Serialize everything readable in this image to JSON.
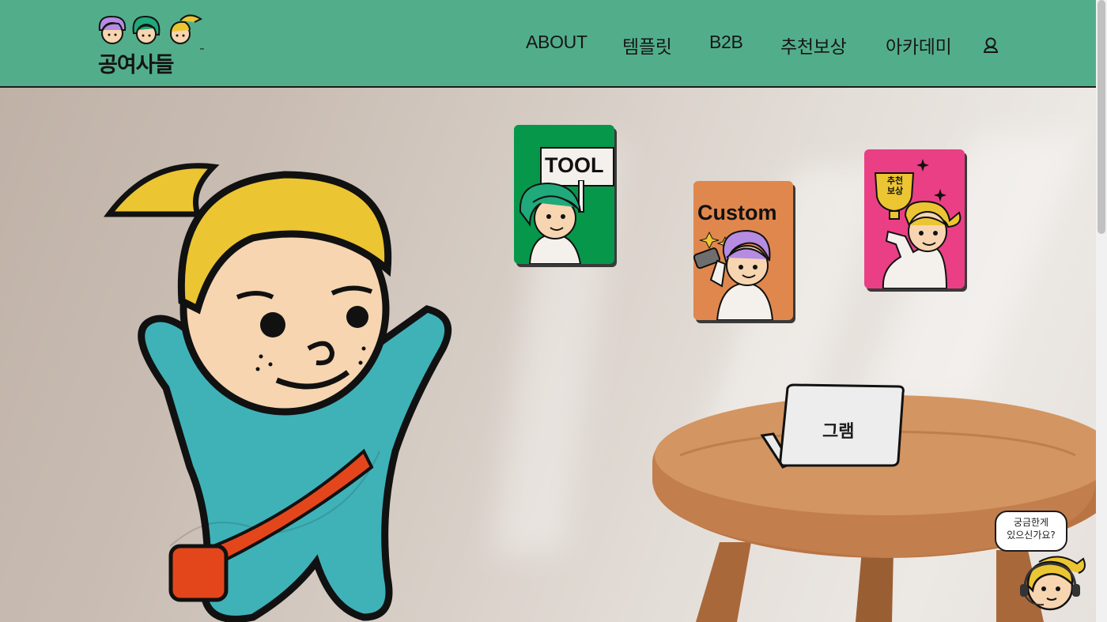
{
  "header": {
    "logo_text": "공여사들",
    "logo_tm": "™",
    "nav": [
      "ABOUT",
      "템플릿",
      "B2B",
      "추천보상",
      "아카데미"
    ],
    "user_icon": "user-icon"
  },
  "hero": {
    "cards": {
      "tool": {
        "label": "TOOL",
        "color": "#06974a"
      },
      "custom": {
        "label": "Custom",
        "color": "#e0874e"
      },
      "reward": {
        "label": "추천\n보상",
        "color": "#ea3f85"
      }
    },
    "laptop_label": "그램",
    "chat_bubble": "궁금한게\n있으신가요?"
  },
  "colors": {
    "header_bg": "#52ae8a",
    "character_hair": "#ecc532",
    "character_body": "#3fb2b8",
    "bag": "#e4461c"
  }
}
